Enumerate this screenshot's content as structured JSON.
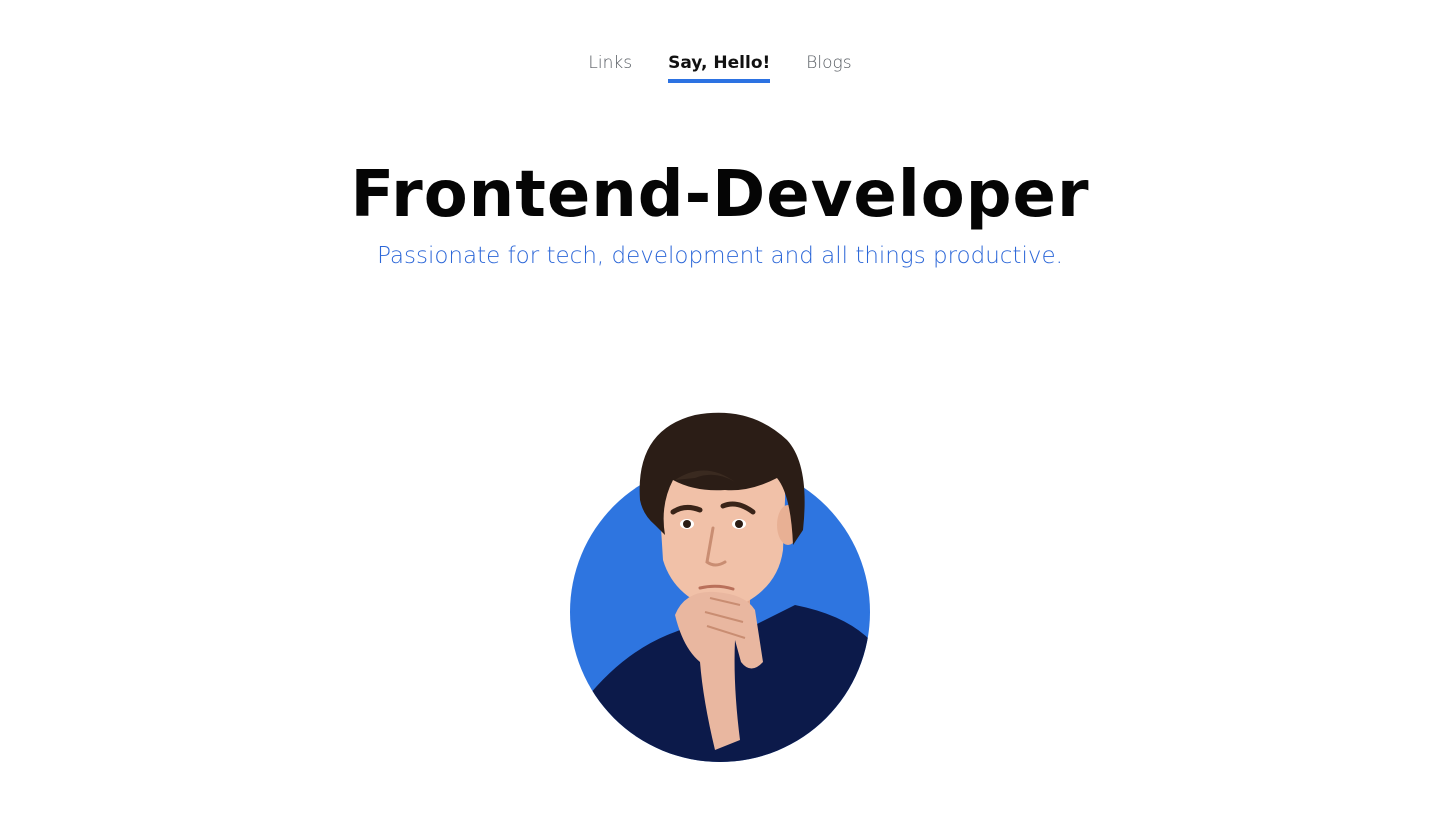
{
  "nav": {
    "items": [
      {
        "label": "Links",
        "active": false
      },
      {
        "label": "Say, Hello!",
        "active": true
      },
      {
        "label": "Blogs",
        "active": false
      }
    ]
  },
  "hero": {
    "title": "Frontend-Developer",
    "subtitle": "Passionate for tech, development and all things productive."
  },
  "colors": {
    "accent": "#2c72e2",
    "subtitle": "#2c67d8",
    "portrait_background": "#2e75e0",
    "shirt": "#0c1a4a"
  },
  "portrait": {
    "icon": "profile-photo"
  }
}
